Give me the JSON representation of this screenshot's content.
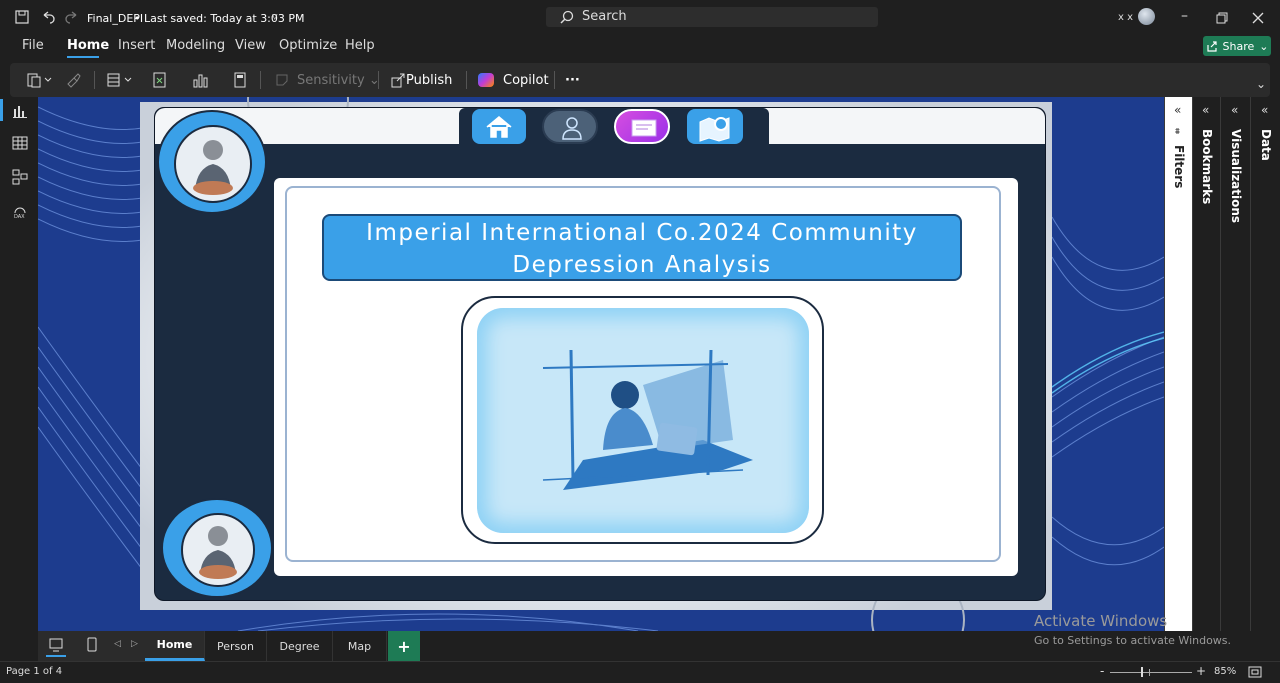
{
  "titlebar": {
    "filename": "Final_DEPI",
    "saved": "• Last saved: Today at 3:03 PM",
    "search_placeholder": "Search",
    "user_initials": "x x"
  },
  "menu": [
    "File",
    "Home",
    "Insert",
    "Modeling",
    "View",
    "Optimize",
    "Help"
  ],
  "share_label": "Share",
  "ribbon": {
    "sensitivity": "Sensitivity",
    "publish": "Publish",
    "copilot": "Copilot",
    "more": "···"
  },
  "report": {
    "title_line1": "Imperial International Co.2024 Community",
    "title_line2": "Depression Analysis",
    "nav_buttons": [
      "home",
      "person",
      "degree",
      "map"
    ]
  },
  "panes": {
    "filters": "Filters",
    "bookmarks": "Bookmarks",
    "visualizations": "Visualizations",
    "data": "Data"
  },
  "tabs": [
    "Home",
    "Person",
    "Degree",
    "Map"
  ],
  "add_tab": "+",
  "watermark": {
    "line1": "Activate Windows",
    "line2": "Go to Settings to activate Windows."
  },
  "status": {
    "page": "Page 1 of 4",
    "zoom": "85%",
    "zoom_minus": "-",
    "zoom_plus": "+"
  },
  "colors": {
    "accent_blue": "#3aa0e8",
    "dark_panel": "#1b2b40",
    "canvas_bg": "#1e3a8a",
    "share_green": "#1e7b55"
  }
}
